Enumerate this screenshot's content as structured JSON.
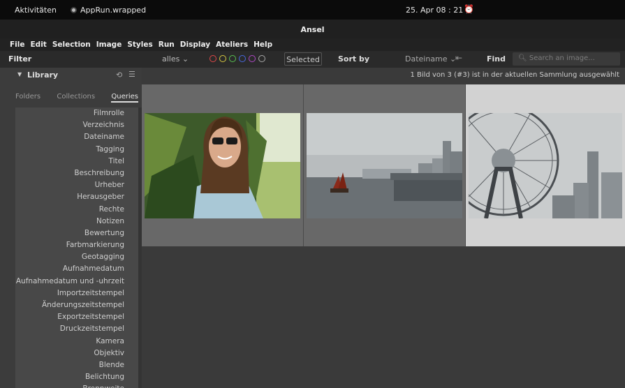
{
  "topbar": {
    "activities": "Aktivitäten",
    "app_name": "AppRun.wrapped",
    "clock": "25. Apr  08 : 21"
  },
  "window": {
    "title": "Ansel"
  },
  "menu": [
    "File",
    "Edit",
    "Selection",
    "Image",
    "Styles",
    "Run",
    "Display",
    "Ateliers",
    "Help"
  ],
  "filterbar": {
    "label": "Filter",
    "rating": "alles  ⌄",
    "color_labels": [
      {
        "name": "red",
        "color": "#e04848"
      },
      {
        "name": "yellow",
        "color": "#d8c840"
      },
      {
        "name": "green",
        "color": "#58c050"
      },
      {
        "name": "blue",
        "color": "#4868e0"
      },
      {
        "name": "purple",
        "color": "#b048c8"
      },
      {
        "name": "grey",
        "color": "#aaaaaa"
      }
    ],
    "selected_button": "Selected",
    "sort_by": "Sort by",
    "sort_field": "Dateiname  ⌄",
    "find": "Find",
    "search_placeholder": "Search an image..."
  },
  "sidebar": {
    "module_title": "Library",
    "tabs": [
      "Folders",
      "Collections",
      "Queries"
    ],
    "active_tab": "Queries",
    "queries": [
      "Filmrolle",
      "Verzeichnis",
      "Dateiname",
      "Tagging",
      "Titel",
      "Beschreibung",
      "Urheber",
      "Herausgeber",
      "Rechte",
      "Notizen",
      "Bewertung",
      "Farbmarkierung",
      "Geotagging",
      "Aufnahmedatum",
      "Aufnahmedatum und -uhrzeit",
      "Importzeitstempel",
      "Änderungszeitstempel",
      "Exportzeitstempel",
      "Druckzeitstempel",
      "Kamera",
      "Objektiv",
      "Blende",
      "Belichtung",
      "Brennweite"
    ]
  },
  "main": {
    "collection_count": "1 Bild von 3 (#3) ist in der aktuellen Sammlung ausgewählt",
    "thumbnails": [
      {
        "name": "portrait",
        "selected": false
      },
      {
        "name": "harbour",
        "selected": false
      },
      {
        "name": "ferris-wheel",
        "selected": true
      }
    ]
  }
}
